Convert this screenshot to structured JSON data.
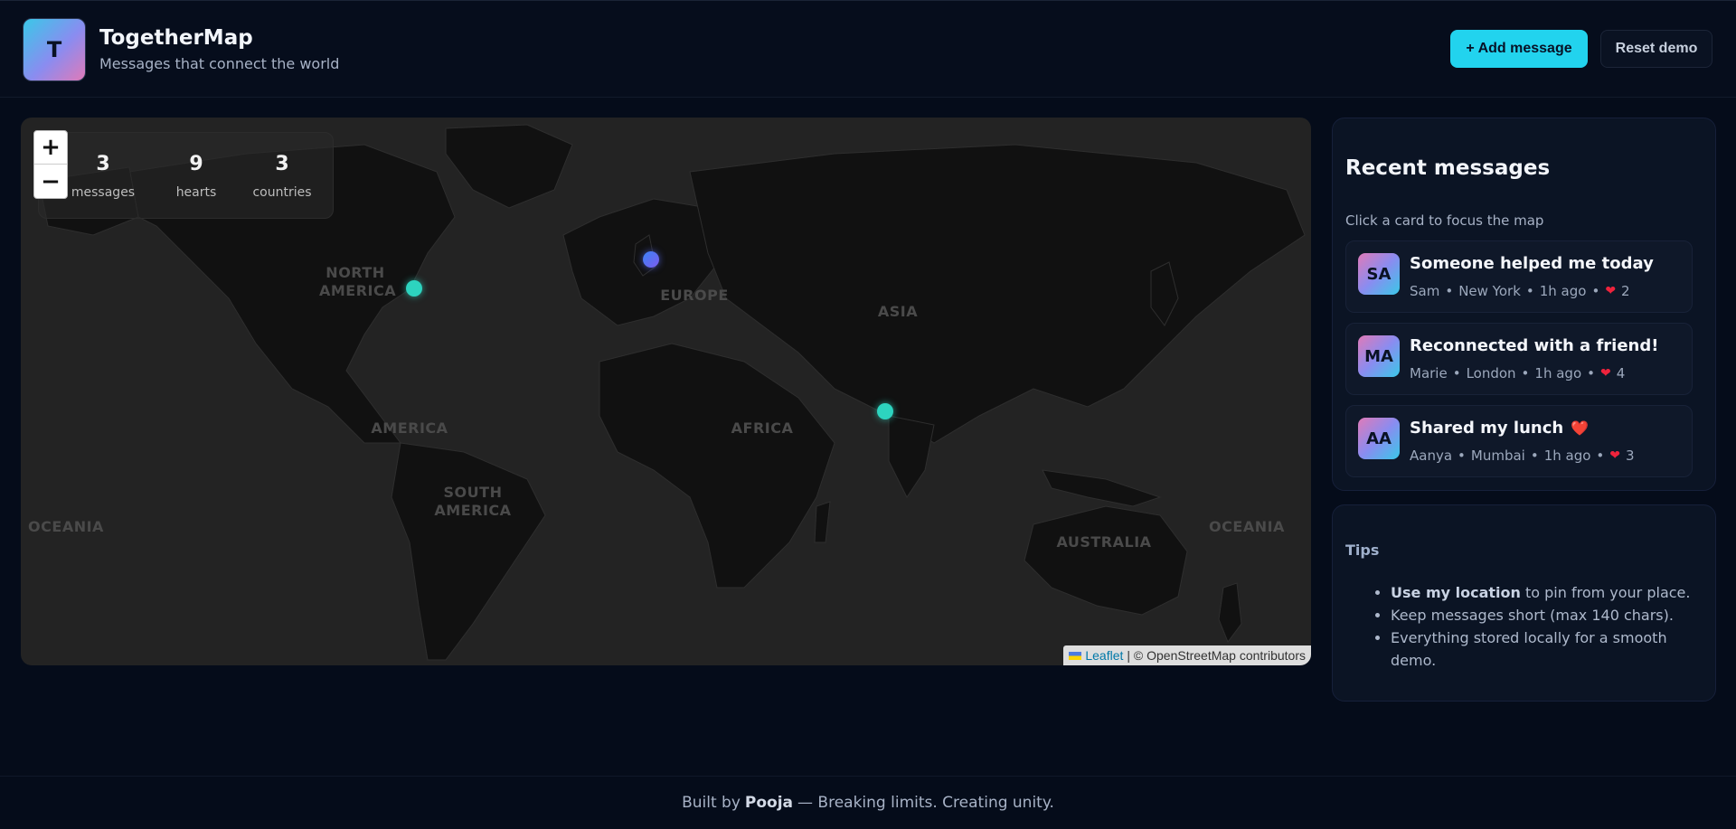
{
  "header": {
    "logo_letter": "T",
    "title": "TogetherMap",
    "subtitle": "Messages that connect the world",
    "add_button": "+ Add message",
    "reset_button": "Reset demo"
  },
  "map": {
    "stats": [
      {
        "value": "3",
        "label": "messages"
      },
      {
        "value": "9",
        "label": "hearts"
      },
      {
        "value": "3",
        "label": "countries"
      }
    ],
    "zoom_in": "+",
    "zoom_out": "−",
    "labels": {
      "north_america": "NORTH AMERICA",
      "europe": "EUROPE",
      "asia": "ASIA",
      "america": "AMERICA",
      "africa": "AFRICA",
      "south_america": "SOUTH AMERICA",
      "oceania_left": "OCEANIA",
      "oceania_right": "OCEANIA",
      "australia": "AUSTRALIA"
    },
    "attribution_leaflet": "Leaflet",
    "attribution_rest": "| © OpenStreetMap contributors"
  },
  "recent": {
    "title": "Recent messages",
    "subtitle": "Click a card to focus the map",
    "cards": [
      {
        "initials": "SA",
        "title": "Someone helped me today",
        "title_heart": "",
        "author": "Sam",
        "city": "New York",
        "time": "1h ago",
        "hearts": "2"
      },
      {
        "initials": "MA",
        "title": "Reconnected with a friend!",
        "title_heart": "",
        "author": "Marie",
        "city": "London",
        "time": "1h ago",
        "hearts": "4"
      },
      {
        "initials": "AA",
        "title": "Shared my lunch",
        "title_heart": "❤️",
        "author": "Aanya",
        "city": "Mumbai",
        "time": "1h ago",
        "hearts": "3"
      }
    ]
  },
  "tips": {
    "title": "Tips",
    "items": [
      {
        "bold": "Use my location",
        "text": " to pin from your place."
      },
      {
        "bold": "",
        "text": "Keep messages short (max 140 chars)."
      },
      {
        "bold": "",
        "text": "Everything stored locally for a smooth demo."
      }
    ]
  },
  "footer": {
    "prefix": "Built by",
    "author": "Pooja",
    "suffix": "— Breaking limits. Creating unity."
  },
  "colors": {
    "accent": "#22d3ee",
    "marker_teal": "#2dd4bf",
    "heart": "#ef233c"
  }
}
